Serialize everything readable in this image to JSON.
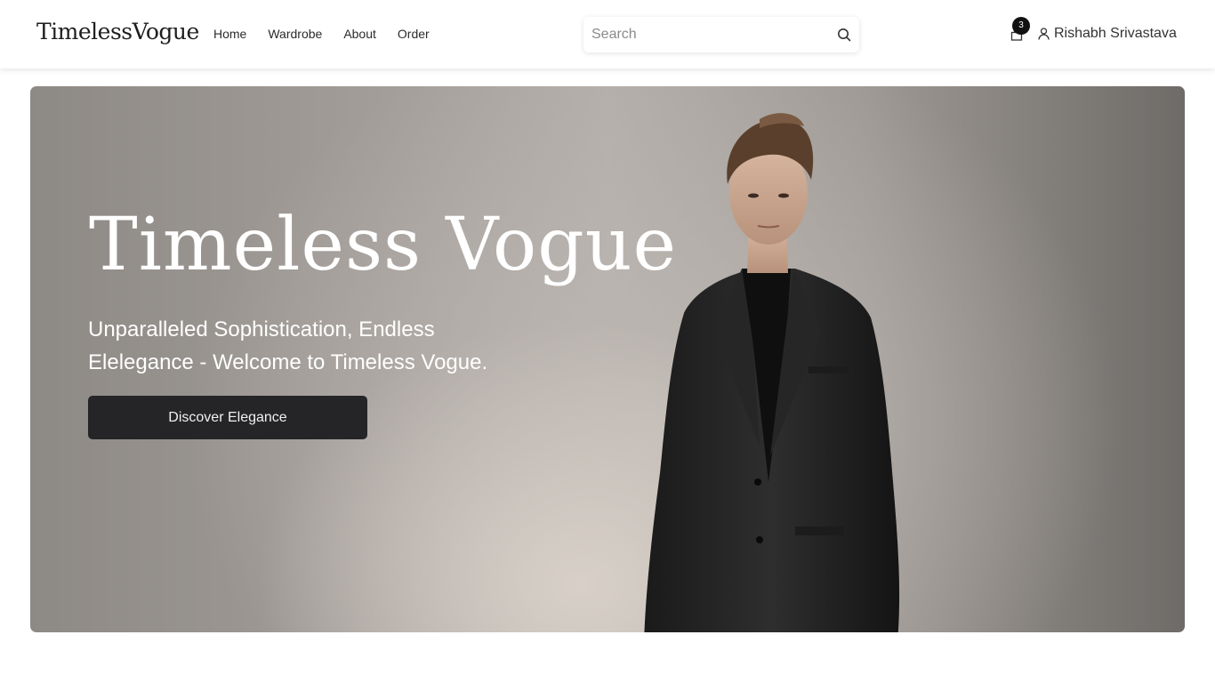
{
  "header": {
    "logo": "TimelessVogue",
    "nav": [
      "Home",
      "Wardrobe",
      "About",
      "Order"
    ],
    "search_placeholder": "Search",
    "cart_count": "3",
    "user_name": "Rishabh Srivastava"
  },
  "hero": {
    "title": "Timeless Vogue",
    "subtitle_line1": "Unparalleled Sophistication, Endless",
    "subtitle_line2": "Elelegance - Welcome to Timeless Vogue.",
    "cta_label": "Discover Elegance",
    "image_subject": "man-in-black-suit",
    "colors": {
      "button": "#252527",
      "text": "#ffffff"
    }
  }
}
